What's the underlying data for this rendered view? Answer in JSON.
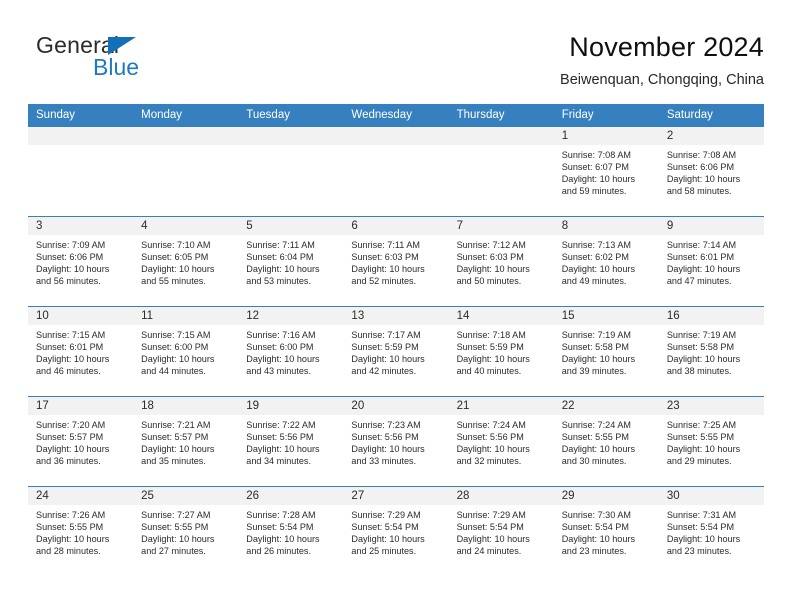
{
  "logo": {
    "word_one": "General",
    "word_two": "Blue",
    "triangle_color": "#146fba",
    "blue_color": "#1f7ac4"
  },
  "header": {
    "title": "November 2024",
    "subtitle": "Beiwenquan, Chongqing, China"
  },
  "theme": {
    "header_blue": "#3680c0",
    "daynum_gray": "#f2f2f2"
  },
  "weekdays": [
    "Sunday",
    "Monday",
    "Tuesday",
    "Wednesday",
    "Thursday",
    "Friday",
    "Saturday"
  ],
  "weeks": [
    [
      {
        "day": "",
        "lines": []
      },
      {
        "day": "",
        "lines": []
      },
      {
        "day": "",
        "lines": []
      },
      {
        "day": "",
        "lines": []
      },
      {
        "day": "",
        "lines": []
      },
      {
        "day": "1",
        "lines": [
          "Sunrise: 7:08 AM",
          "Sunset: 6:07 PM",
          "Daylight: 10 hours",
          "and 59 minutes."
        ]
      },
      {
        "day": "2",
        "lines": [
          "Sunrise: 7:08 AM",
          "Sunset: 6:06 PM",
          "Daylight: 10 hours",
          "and 58 minutes."
        ]
      }
    ],
    [
      {
        "day": "3",
        "lines": [
          "Sunrise: 7:09 AM",
          "Sunset: 6:06 PM",
          "Daylight: 10 hours",
          "and 56 minutes."
        ]
      },
      {
        "day": "4",
        "lines": [
          "Sunrise: 7:10 AM",
          "Sunset: 6:05 PM",
          "Daylight: 10 hours",
          "and 55 minutes."
        ]
      },
      {
        "day": "5",
        "lines": [
          "Sunrise: 7:11 AM",
          "Sunset: 6:04 PM",
          "Daylight: 10 hours",
          "and 53 minutes."
        ]
      },
      {
        "day": "6",
        "lines": [
          "Sunrise: 7:11 AM",
          "Sunset: 6:03 PM",
          "Daylight: 10 hours",
          "and 52 minutes."
        ]
      },
      {
        "day": "7",
        "lines": [
          "Sunrise: 7:12 AM",
          "Sunset: 6:03 PM",
          "Daylight: 10 hours",
          "and 50 minutes."
        ]
      },
      {
        "day": "8",
        "lines": [
          "Sunrise: 7:13 AM",
          "Sunset: 6:02 PM",
          "Daylight: 10 hours",
          "and 49 minutes."
        ]
      },
      {
        "day": "9",
        "lines": [
          "Sunrise: 7:14 AM",
          "Sunset: 6:01 PM",
          "Daylight: 10 hours",
          "and 47 minutes."
        ]
      }
    ],
    [
      {
        "day": "10",
        "lines": [
          "Sunrise: 7:15 AM",
          "Sunset: 6:01 PM",
          "Daylight: 10 hours",
          "and 46 minutes."
        ]
      },
      {
        "day": "11",
        "lines": [
          "Sunrise: 7:15 AM",
          "Sunset: 6:00 PM",
          "Daylight: 10 hours",
          "and 44 minutes."
        ]
      },
      {
        "day": "12",
        "lines": [
          "Sunrise: 7:16 AM",
          "Sunset: 6:00 PM",
          "Daylight: 10 hours",
          "and 43 minutes."
        ]
      },
      {
        "day": "13",
        "lines": [
          "Sunrise: 7:17 AM",
          "Sunset: 5:59 PM",
          "Daylight: 10 hours",
          "and 42 minutes."
        ]
      },
      {
        "day": "14",
        "lines": [
          "Sunrise: 7:18 AM",
          "Sunset: 5:59 PM",
          "Daylight: 10 hours",
          "and 40 minutes."
        ]
      },
      {
        "day": "15",
        "lines": [
          "Sunrise: 7:19 AM",
          "Sunset: 5:58 PM",
          "Daylight: 10 hours",
          "and 39 minutes."
        ]
      },
      {
        "day": "16",
        "lines": [
          "Sunrise: 7:19 AM",
          "Sunset: 5:58 PM",
          "Daylight: 10 hours",
          "and 38 minutes."
        ]
      }
    ],
    [
      {
        "day": "17",
        "lines": [
          "Sunrise: 7:20 AM",
          "Sunset: 5:57 PM",
          "Daylight: 10 hours",
          "and 36 minutes."
        ]
      },
      {
        "day": "18",
        "lines": [
          "Sunrise: 7:21 AM",
          "Sunset: 5:57 PM",
          "Daylight: 10 hours",
          "and 35 minutes."
        ]
      },
      {
        "day": "19",
        "lines": [
          "Sunrise: 7:22 AM",
          "Sunset: 5:56 PM",
          "Daylight: 10 hours",
          "and 34 minutes."
        ]
      },
      {
        "day": "20",
        "lines": [
          "Sunrise: 7:23 AM",
          "Sunset: 5:56 PM",
          "Daylight: 10 hours",
          "and 33 minutes."
        ]
      },
      {
        "day": "21",
        "lines": [
          "Sunrise: 7:24 AM",
          "Sunset: 5:56 PM",
          "Daylight: 10 hours",
          "and 32 minutes."
        ]
      },
      {
        "day": "22",
        "lines": [
          "Sunrise: 7:24 AM",
          "Sunset: 5:55 PM",
          "Daylight: 10 hours",
          "and 30 minutes."
        ]
      },
      {
        "day": "23",
        "lines": [
          "Sunrise: 7:25 AM",
          "Sunset: 5:55 PM",
          "Daylight: 10 hours",
          "and 29 minutes."
        ]
      }
    ],
    [
      {
        "day": "24",
        "lines": [
          "Sunrise: 7:26 AM",
          "Sunset: 5:55 PM",
          "Daylight: 10 hours",
          "and 28 minutes."
        ]
      },
      {
        "day": "25",
        "lines": [
          "Sunrise: 7:27 AM",
          "Sunset: 5:55 PM",
          "Daylight: 10 hours",
          "and 27 minutes."
        ]
      },
      {
        "day": "26",
        "lines": [
          "Sunrise: 7:28 AM",
          "Sunset: 5:54 PM",
          "Daylight: 10 hours",
          "and 26 minutes."
        ]
      },
      {
        "day": "27",
        "lines": [
          "Sunrise: 7:29 AM",
          "Sunset: 5:54 PM",
          "Daylight: 10 hours",
          "and 25 minutes."
        ]
      },
      {
        "day": "28",
        "lines": [
          "Sunrise: 7:29 AM",
          "Sunset: 5:54 PM",
          "Daylight: 10 hours",
          "and 24 minutes."
        ]
      },
      {
        "day": "29",
        "lines": [
          "Sunrise: 7:30 AM",
          "Sunset: 5:54 PM",
          "Daylight: 10 hours",
          "and 23 minutes."
        ]
      },
      {
        "day": "30",
        "lines": [
          "Sunrise: 7:31 AM",
          "Sunset: 5:54 PM",
          "Daylight: 10 hours",
          "and 23 minutes."
        ]
      }
    ]
  ]
}
